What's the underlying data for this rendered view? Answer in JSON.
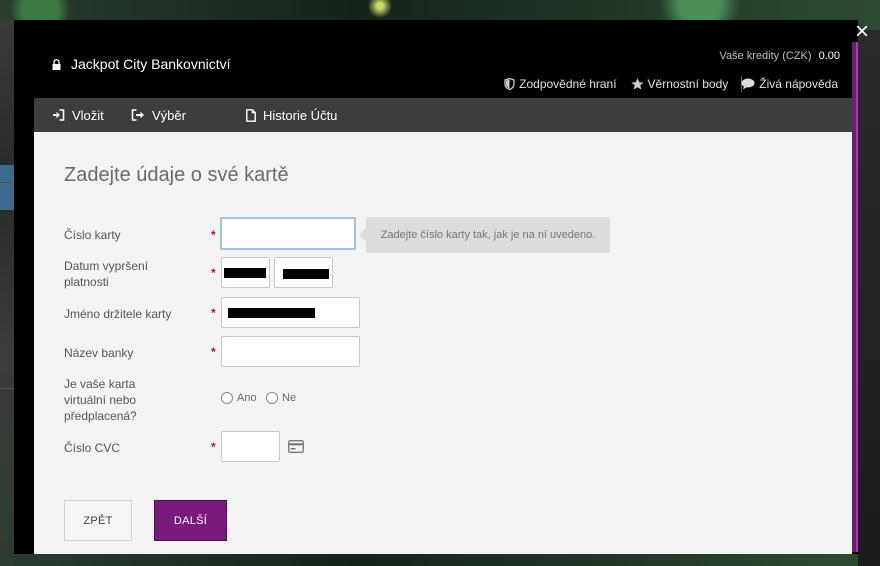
{
  "window": {
    "title": "Jackpot City Bankovnictví",
    "close_label": "×"
  },
  "credits": {
    "label": "Vaše kredity (CZK)",
    "value": "0.00"
  },
  "util_links": [
    {
      "label": "Zodpovědné hraní",
      "icon": "shield-icon"
    },
    {
      "label": "Věrnostní body",
      "icon": "star-icon"
    },
    {
      "label": "Živá nápověda",
      "icon": "chat-bubble-icon"
    }
  ],
  "tabs": [
    {
      "label": "Vložit",
      "icon": "sign-in-icon"
    },
    {
      "label": "Výběr",
      "icon": "sign-out-icon"
    },
    {
      "label": "Historie Účtu",
      "icon": "document-icon"
    }
  ],
  "form": {
    "heading": "Zadejte údaje o své kartě",
    "card_number": {
      "label": "Číslo karty",
      "value": "",
      "tooltip": "Zadejte číslo karty tak, jak je na ní uvedeno."
    },
    "expiry": {
      "label_line1": "Datum vypršení",
      "label_line2": "platnosti"
    },
    "holder": {
      "label": "Jméno držitele karty"
    },
    "bank": {
      "label": "Název banky",
      "value": ""
    },
    "prepaid": {
      "label_line1": "Je vaše karta",
      "label_line2": "virtuální nebo",
      "label_line3": "předplacená?",
      "option_yes": "Ano",
      "option_no": "Ne"
    },
    "cvc": {
      "label": "Číslo CVC",
      "value": ""
    },
    "required_mark": "*"
  },
  "buttons": {
    "back": "ZPĚT",
    "next": "DALŠÍ"
  },
  "colors": {
    "accent": "#7a1a7e",
    "required": "#c0161b",
    "tab_bar": "#3d3d3d",
    "header": "#000000"
  }
}
